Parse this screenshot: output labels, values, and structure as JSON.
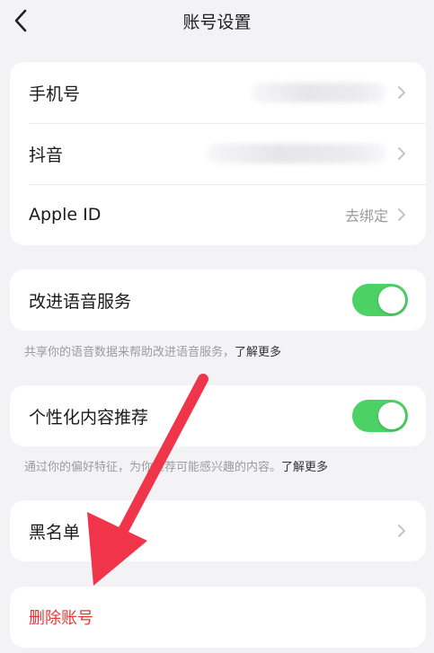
{
  "header": {
    "title": "账号设置"
  },
  "bindings": {
    "rows": [
      {
        "label": "手机号",
        "value": ""
      },
      {
        "label": "抖音",
        "value": ""
      },
      {
        "label": "Apple ID",
        "value": "去绑定"
      }
    ]
  },
  "voice": {
    "label": "改进语音服务",
    "enabled": true,
    "note": "共享你的语音数据来帮助改进语音服务，",
    "more": "了解更多"
  },
  "personalized": {
    "label": "个性化内容推荐",
    "enabled": true,
    "note": "通过你的偏好特征，为你推荐可能感兴趣的内容。",
    "more": "了解更多"
  },
  "blacklist": {
    "label": "黑名单"
  },
  "delete": {
    "label": "删除账号"
  },
  "colors": {
    "toggle_on": "#4cd164",
    "danger": "#e53935",
    "arrow": "#f0344a"
  },
  "icons": {
    "back": "chevron-left-icon",
    "row": "chevron-right-icon"
  }
}
